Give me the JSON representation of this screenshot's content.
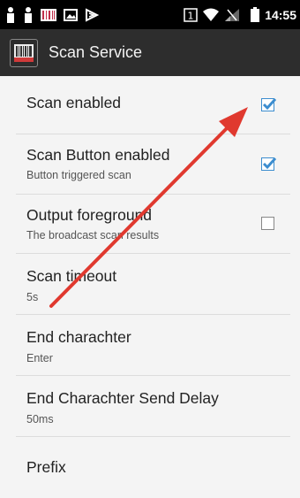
{
  "status_bar": {
    "time": "14:55",
    "sim_badge": "1"
  },
  "app_bar": {
    "title": "Scan Service"
  },
  "settings": [
    {
      "title": "Scan enabled",
      "checked": true
    },
    {
      "title": "Scan Button enabled",
      "subtitle": "Button triggered scan",
      "checked": true
    },
    {
      "title": "Output foreground",
      "subtitle": "The broadcast scan results",
      "checked": false
    },
    {
      "title": "Scan timeout",
      "subtitle": "5s"
    },
    {
      "title": "End charachter",
      "subtitle": "Enter"
    },
    {
      "title": "End Charachter Send Delay",
      "subtitle": "50ms"
    },
    {
      "title": "Prefix"
    }
  ],
  "colors": {
    "checkbox_accent": "#3c8dcf",
    "annotation_arrow": "#e0392f"
  }
}
